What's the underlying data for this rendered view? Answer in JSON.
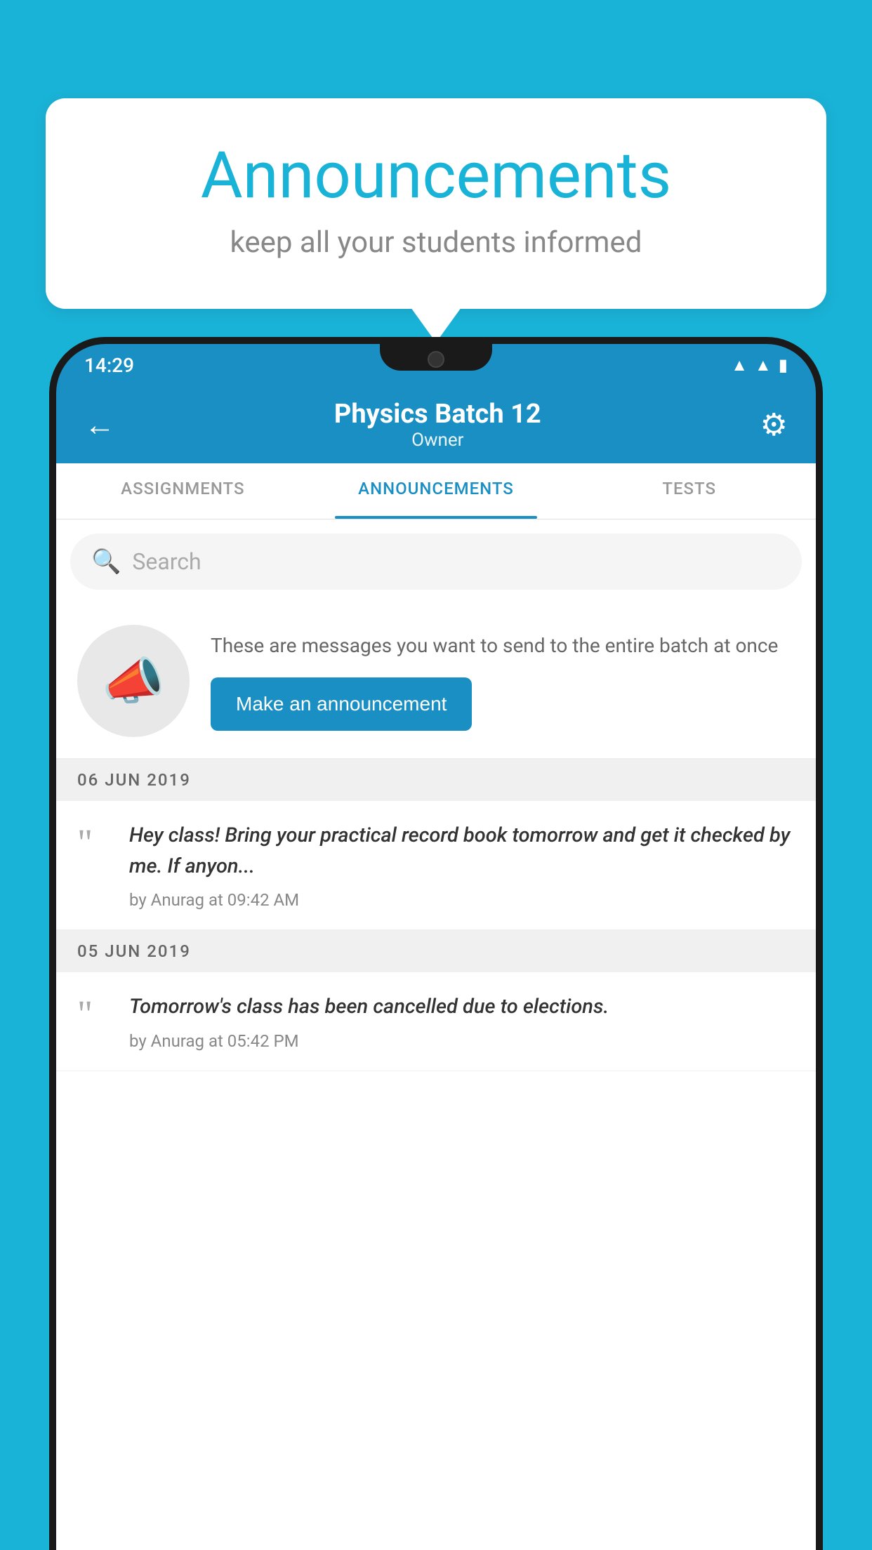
{
  "background_color": "#1ab3d8",
  "bubble": {
    "title": "Announcements",
    "subtitle": "keep all your students informed"
  },
  "phone": {
    "status_bar": {
      "time": "14:29"
    },
    "header": {
      "title": "Physics Batch 12",
      "subtitle": "Owner"
    },
    "tabs": [
      {
        "label": "ASSIGNMENTS",
        "active": false
      },
      {
        "label": "ANNOUNCEMENTS",
        "active": true
      },
      {
        "label": "TESTS",
        "active": false
      }
    ],
    "search": {
      "placeholder": "Search"
    },
    "promo": {
      "text": "These are messages you want to send to the entire batch at once",
      "button_label": "Make an announcement"
    },
    "announcements": [
      {
        "date": "06  JUN  2019",
        "text": "Hey class! Bring your practical record book tomorrow and get it checked by me. If anyon...",
        "meta": "by Anurag at 09:42 AM"
      },
      {
        "date": "05  JUN  2019",
        "text": "Tomorrow's class has been cancelled due to elections.",
        "meta": "by Anurag at 05:42 PM"
      }
    ]
  }
}
